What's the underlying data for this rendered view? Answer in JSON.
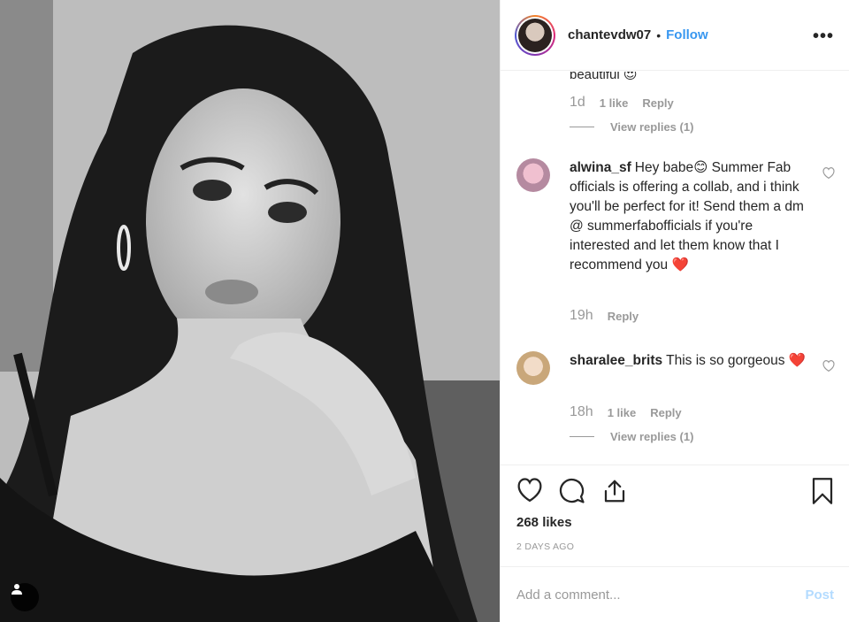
{
  "post": {
    "header": {
      "username": "chantevdw07",
      "separator": "•",
      "follow_label": "Follow",
      "more_icon": "more-options-icon"
    },
    "comments_top": {
      "partial_text": "beautiful 😍",
      "time": "1d",
      "likes": "1 like",
      "reply_label": "Reply",
      "view_replies": "View replies (1)"
    },
    "comments": [
      {
        "username": "alwina_sf",
        "text": "Hey babe😊 Summer Fab officials is offering a collab, and i think you'll be perfect for it! Send them a dm @ summerfabofficials if you're interested and let them know that I recommend you ❤️",
        "time": "19h",
        "reply_label": "Reply"
      },
      {
        "username": "sharalee_brits",
        "text": "This is so gorgeous ❤️",
        "time": "18h",
        "likes": "1 like",
        "reply_label": "Reply",
        "view_replies": "View replies (1)"
      }
    ],
    "likes_count": "268 likes",
    "date": "2 DAYS AGO",
    "add_comment_placeholder": "Add a comment...",
    "post_label": "Post"
  },
  "colors": {
    "link_blue": "#3897f0",
    "post_disabled": "#b3dbff",
    "meta_gray": "#999999",
    "border": "#efefef"
  }
}
